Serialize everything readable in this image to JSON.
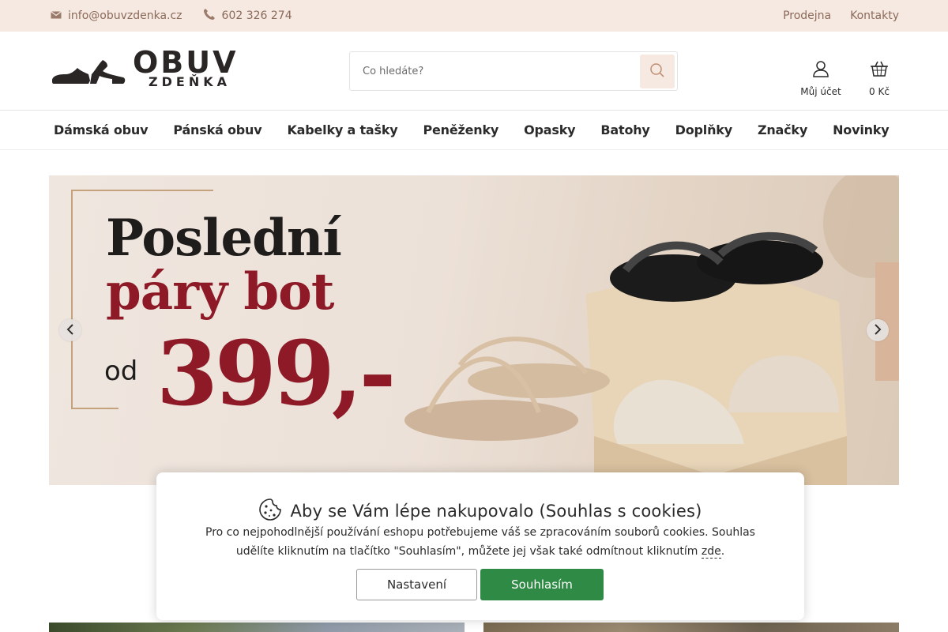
{
  "topbar": {
    "email": "info@obuvzdenka.cz",
    "phone": "602 326 274",
    "links": [
      "Prodejna",
      "Kontakty"
    ],
    "email_icon": "envelope-icon",
    "phone_icon": "phone-icon"
  },
  "logo": {
    "main": "OBUV",
    "sub": "ZDEŇKA"
  },
  "search": {
    "placeholder": "Co hledáte?",
    "icon": "search-icon"
  },
  "account": {
    "label": "Můj účet",
    "icon": "user-icon"
  },
  "cart": {
    "label": "0 Kč",
    "icon": "basket-icon"
  },
  "nav": {
    "items": [
      "Dámská obuv",
      "Pánská obuv",
      "Kabelky a tašky",
      "Peněženky",
      "Opasky",
      "Batohy",
      "Doplňky",
      "Značky",
      "Novinky"
    ]
  },
  "banner": {
    "line1": "Poslední",
    "line2": "páry bot",
    "od": "od",
    "price": "399,-"
  },
  "cookie": {
    "title": "Aby se Vám lépe nakupovalo (Souhlas s cookies)",
    "text": "Pro co nejpohodlnější používání eshopu potřebujeme váš se zpracováním souborů cookies. Souhlas udělíte kliknutím na tlačítko \"Souhlasím\", můžete jej však také odmítnout kliknutím",
    "link": "zde",
    "text_end": ".",
    "settings_label": "Nastavení",
    "accept_label": "Souhlasím",
    "icon": "cookie-icon"
  },
  "colors": {
    "topbar_bg": "#f6e9e1",
    "accent_red": "#8d1a26",
    "accept_green": "#2e8a45"
  }
}
